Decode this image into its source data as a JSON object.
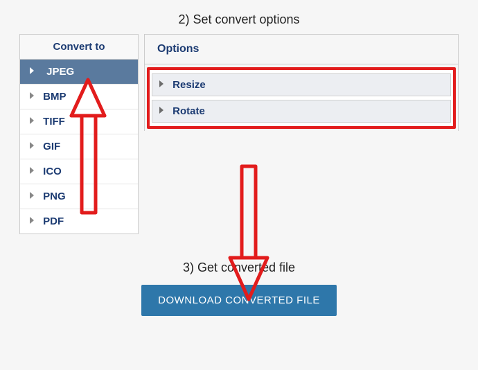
{
  "step2_title": "2) Set convert options",
  "sidebar": {
    "header": "Convert to",
    "items": [
      {
        "label": "JPEG",
        "active": true
      },
      {
        "label": "BMP",
        "active": false
      },
      {
        "label": "TIFF",
        "active": false
      },
      {
        "label": "GIF",
        "active": false
      },
      {
        "label": "ICO",
        "active": false
      },
      {
        "label": "PNG",
        "active": false
      },
      {
        "label": "PDF",
        "active": false
      }
    ]
  },
  "options": {
    "header": "Options",
    "rows": [
      {
        "label": "Resize"
      },
      {
        "label": "Rotate"
      }
    ]
  },
  "step3_title": "3) Get converted file",
  "download_button": "DOWNLOAD CONVERTED FILE",
  "annotations": {
    "highlight_color": "#e21c1c"
  }
}
